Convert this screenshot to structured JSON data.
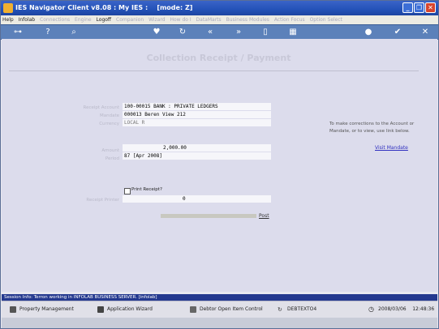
{
  "window": {
    "title": "IES Navigator Client v8.08 : My IES :",
    "mode": "[mode: Z]"
  },
  "menubar": {
    "items": [
      {
        "label": "Help",
        "enabled": true
      },
      {
        "label": "Infolab",
        "enabled": true
      },
      {
        "label": "Connections",
        "enabled": false
      },
      {
        "label": "Engine",
        "enabled": false
      },
      {
        "label": "Logoff",
        "enabled": true
      },
      {
        "label": "Companion",
        "enabled": false
      },
      {
        "label": "Wizard",
        "enabled": false
      },
      {
        "label": "How do I",
        "enabled": false
      },
      {
        "label": "DataMarts",
        "enabled": false
      },
      {
        "label": "Business Modules",
        "enabled": false
      },
      {
        "label": "Action Focus",
        "enabled": false
      },
      {
        "label": "Option Select",
        "enabled": false
      }
    ]
  },
  "toolbar": {
    "icons": [
      "key-icon",
      "help-icon",
      "search-icon",
      "heart-icon",
      "refresh-icon",
      "back-icon",
      "forward-icon",
      "document-icon",
      "grid-icon",
      "stop-icon",
      "check-icon",
      "close-icon"
    ]
  },
  "form": {
    "title": "Collection Receipt / Payment",
    "fields": {
      "receipt_account": {
        "label": "Receipt Account",
        "value": "100-00015 BANK : PRIVATE LEDGERS"
      },
      "mandate": {
        "label": "Mandate",
        "value": "000013 Beren View 212"
      },
      "currency": {
        "label": "Currency",
        "value": "LOCAL R"
      },
      "amount": {
        "label": "Amount",
        "value": "2,000.00"
      },
      "period": {
        "label": "Period",
        "value": "87  [Apr 2008]"
      },
      "receipt_printer": {
        "label": "Receipt Printer",
        "value": "0"
      }
    },
    "print_receipt_label": "Print Receipt?",
    "print_receipt_checked": false,
    "note": "To make corrections to the Account or Mandate, or to view, use link below.",
    "visit_mandate_link": "Visit Mandate",
    "post_link": "Post"
  },
  "session": {
    "text": "Session Info: Terron working in INFOLAB BUSINESS SERVER. [infolab]"
  },
  "taskbar": {
    "items": [
      {
        "label": "Property Management",
        "icon": "building-icon"
      },
      {
        "label": "Application Wizard",
        "icon": "wizard-icon"
      },
      {
        "label": "Debtor Open Item Control",
        "icon": "debtor-icon"
      },
      {
        "label": "DEBTEXTO4",
        "icon": "refresh-icon"
      }
    ],
    "date": "2008/03/06",
    "time": "12:48:36"
  },
  "colors": {
    "titlebar": "#2452b8",
    "toolbar": "#5c81ba",
    "session_bar": "#24398f",
    "link": "#3030c0"
  }
}
